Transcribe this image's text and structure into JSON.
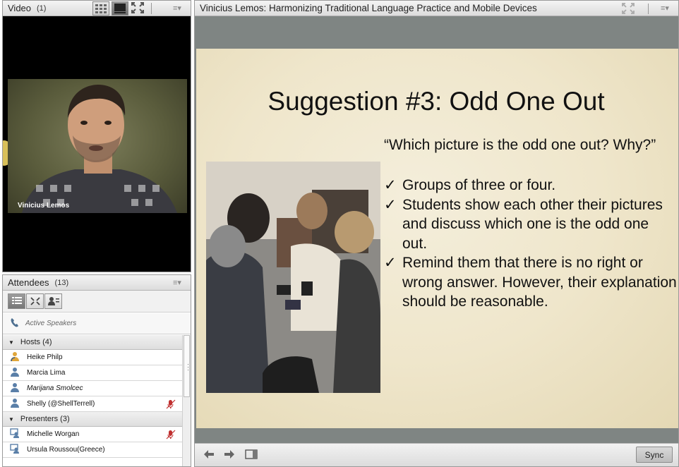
{
  "video_pod": {
    "title": "Video",
    "count": "(1)",
    "presenter_name": "Vinicius Lemos"
  },
  "attendees_pod": {
    "title": "Attendees",
    "count": "(13)",
    "active_speakers_label": "Active Speakers",
    "groups": [
      {
        "label": "Hosts (4)",
        "people": [
          {
            "name": "Heike Philp",
            "italic": false,
            "mic": false
          },
          {
            "name": "Marcia Lima",
            "italic": false,
            "mic": false
          },
          {
            "name": "Marijana Smolcec",
            "italic": true,
            "mic": false
          },
          {
            "name": "Shelly (@ShellTerrell)",
            "italic": false,
            "mic": true
          }
        ]
      },
      {
        "label": "Presenters (3)",
        "people": [
          {
            "name": "Michelle Worgan",
            "italic": false,
            "mic": true
          },
          {
            "name": "Ursula Roussou(Greece)",
            "italic": false,
            "mic": false
          }
        ]
      }
    ]
  },
  "share_pod": {
    "title": "Vinicius Lemos: Harmonizing Traditional Language Practice and Mobile Devices",
    "sync_label": "Sync",
    "slide": {
      "title": "Suggestion #3: Odd One Out",
      "quote": "“Which picture is the odd one out? Why?”",
      "bullets": [
        "Groups of three or four.",
        "Students show each other their pictures and discuss which one is the odd one out.",
        "Remind them that there is no right or wrong answer. However, their explanation should be reasonable."
      ],
      "check_glyph": "✓"
    }
  },
  "colors": {
    "slide_bg": "#efe6cb",
    "share_bg": "#7f8583",
    "video_bg": "#000000"
  }
}
